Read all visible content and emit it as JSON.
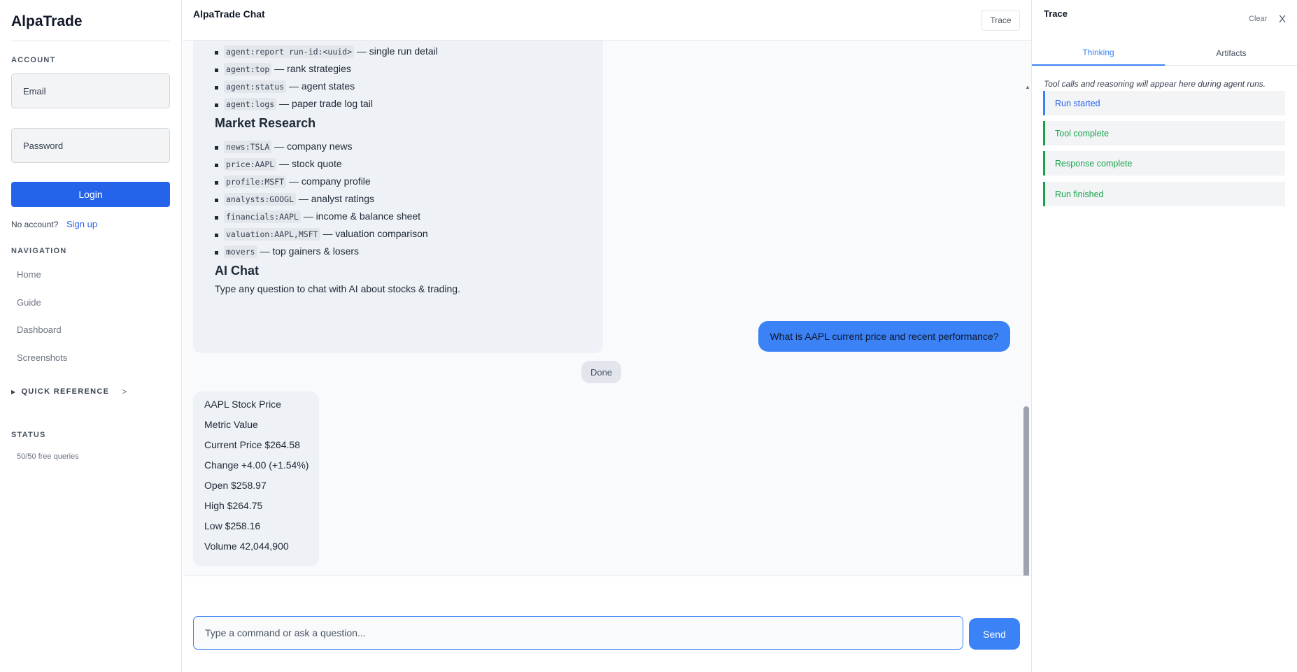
{
  "sidebar": {
    "brand": "AlpaTrade",
    "account": {
      "title": "ACCOUNT",
      "email_placeholder": "Email",
      "password_placeholder": "Password",
      "login_label": "Login",
      "no_account_text": "No account?",
      "signup_label": "Sign up"
    },
    "navigation": {
      "title": "NAVIGATION",
      "items": [
        "Home",
        "Guide",
        "Dashboard",
        "Screenshots"
      ]
    },
    "quick_reference": "QUICK REFERENCE",
    "status": {
      "title": "STATUS",
      "queries": "50/50 free queries"
    }
  },
  "main": {
    "title": "AlpaTrade Chat",
    "trace_button": "Trace",
    "agent_commands": [
      {
        "code": "agent:report run-id:<uuid>",
        "desc": "— single run detail"
      },
      {
        "code": "agent:top",
        "desc": "— rank strategies"
      },
      {
        "code": "agent:status",
        "desc": "— agent states"
      },
      {
        "code": "agent:logs",
        "desc": "— paper trade log tail"
      }
    ],
    "market_research": {
      "heading": "Market Research",
      "commands": [
        {
          "code": "news:TSLA",
          "desc": "— company news"
        },
        {
          "code": "price:AAPL",
          "desc": "— stock quote"
        },
        {
          "code": "profile:MSFT",
          "desc": "— company profile"
        },
        {
          "code": "analysts:GOOGL",
          "desc": "— analyst ratings"
        },
        {
          "code": "financials:AAPL",
          "desc": "— income & balance sheet"
        },
        {
          "code": "valuation:AAPL,MSFT",
          "desc": "— valuation comparison"
        },
        {
          "code": "movers",
          "desc": "— top gainers & losers"
        }
      ]
    },
    "ai_chat": {
      "heading": "AI Chat",
      "description": "Type any question to chat with AI about stocks & trading."
    },
    "user_message": "What is AAPL current price and recent performance?",
    "done_label": "Done",
    "stock_response": [
      "AAPL Stock Price",
      "Metric Value",
      "Current Price $264.58",
      "Change +4.00 (+1.54%)",
      "Open $258.97",
      "High $264.75",
      "Low $258.16",
      "Volume 42,044,900"
    ],
    "composer_placeholder": "Type a command or ask a question...",
    "send_label": "Send"
  },
  "trace": {
    "title": "Trace",
    "clear_label": "Clear",
    "close_label": "X",
    "tabs": [
      "Thinking",
      "Artifacts"
    ],
    "hint": "Tool calls and reasoning will appear here during agent runs.",
    "events": [
      "Run started",
      "Tool complete",
      "Response complete",
      "Run finished"
    ]
  },
  "colors": {
    "accent": "#3b82f6",
    "login_button": "#2563eb",
    "event_blue": "#3b82f6",
    "event_green": "#16a34a"
  }
}
